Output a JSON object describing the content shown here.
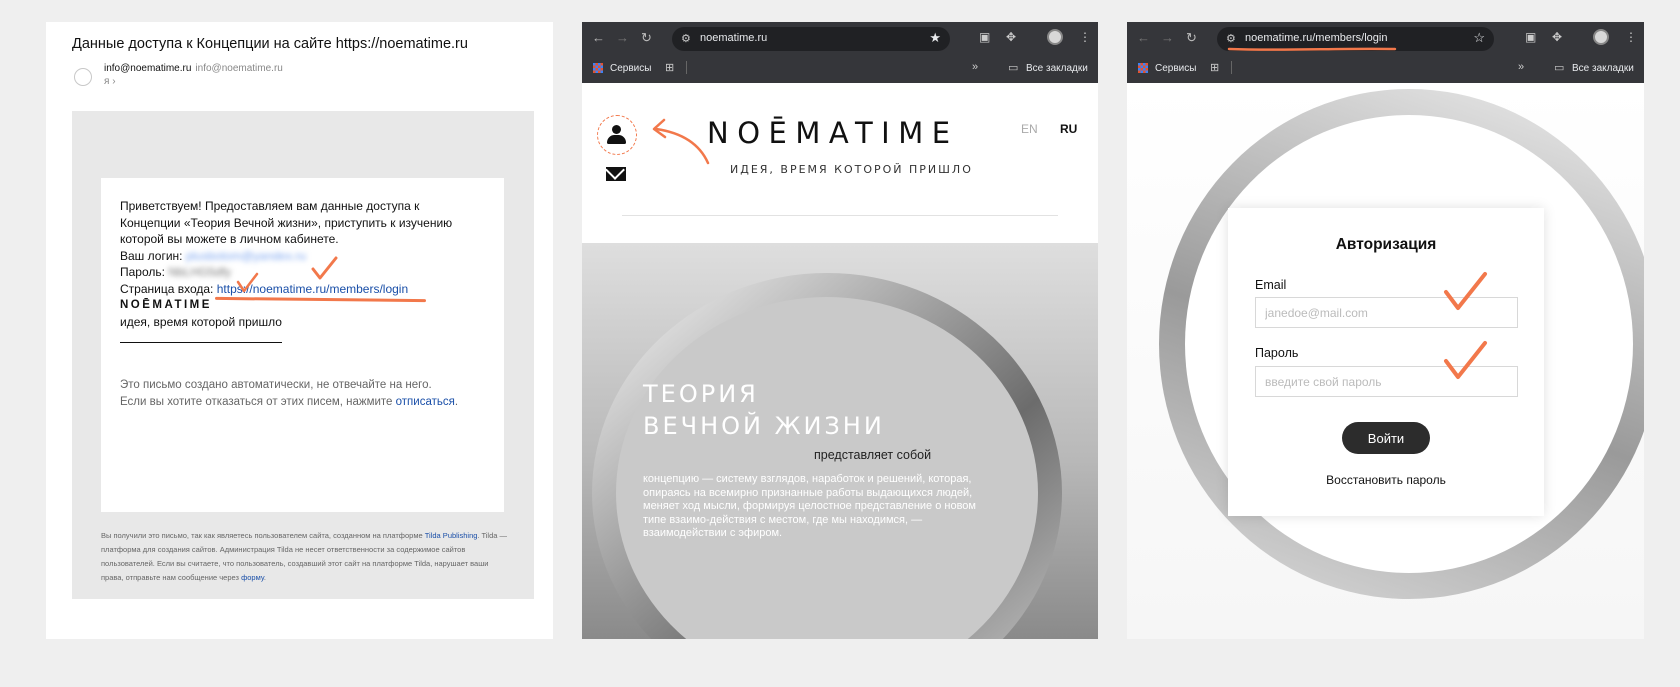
{
  "email": {
    "subject": "Данные доступа к Концепции на сайте https://noematime.ru",
    "from_name": "info@noematime.ru",
    "from_email": "info@noematime.ru",
    "to": "я ›",
    "greeting": "Приветствуем! Предоставляем вам данные доступа к Концепции «Теория Вечной жизни», приступить к изучению которой вы можете в личном кабинете.",
    "login_label": "Ваш логин:",
    "login_value": "plusbotom@yandex.ru",
    "password_label": "Пароль:",
    "password_value": "NbLHG5dfy",
    "login_page_label": "Страница входа:",
    "login_page_url": "https://noematime.ru/members/login",
    "brand": "NOĒMATIME",
    "tagline": "идея, время которой пришло",
    "notice_line1": "Это письмо создано автоматически, не отвечайте на него.",
    "notice_line2_prefix": "Если вы хотите отказаться от этих писем, нажмите",
    "unsubscribe": "отписаться",
    "notice_line2_suffix": ".",
    "footer_prefix": "Вы получили это письмо, так как являетесь пользователем сайта, созданном на платформе",
    "footer_link1": "Tilda Publishing",
    "footer_middle": ". Tilda — платформа для создания сайтов. Администрация Tilda не несет ответственности за содержимое сайтов пользователей. Если вы считаете, что пользователь, создавший этот сайт на платформе Tilda, нарушает ваши права, отправьте нам сообщение через",
    "footer_link2": "форму",
    "footer_suffix": "."
  },
  "browser_site": {
    "url": "noematime.ru",
    "bookmark_services": "Сервисы",
    "all_bookmarks": "Все закладки",
    "logo": "NOĒMATIME",
    "slogan": "ИДЕЯ, ВРЕМЯ КОТОРОЙ ПРИШЛО",
    "lang_en": "EN",
    "lang_ru": "RU",
    "hero_title_line1": "ТЕОРИЯ",
    "hero_title_line2": "ВЕЧНОЙ ЖИЗНИ",
    "hero_sub": "представляет собой",
    "hero_body": "концепцию — систему взглядов, наработок и решений, которая, опираясь на всемирно признанные работы выдающихся людей, меняет ход мысли, формируя целостное представление о новом типе взаимо-действия с местом, где мы находимся, — взаимодействии с эфиром."
  },
  "browser_auth": {
    "url": "noematime.ru/members/login",
    "bookmark_services": "Сервисы",
    "all_bookmarks": "Все закладки",
    "title": "Авторизация",
    "email_label": "Email",
    "email_placeholder": "janedoe@mail.com",
    "password_label": "Пароль",
    "password_placeholder": "введите свой пароль",
    "login_button": "Войти",
    "restore_link": "Восстановить пароль"
  },
  "colors": {
    "annotation": "#f2784b",
    "link": "#1a4fa8",
    "chrome": "#35363a",
    "button": "#2c2c2c"
  },
  "icons": [
    "back-arrow-icon",
    "forward-arrow-icon",
    "reload-icon",
    "site-settings-icon",
    "star-icon",
    "extension-icon",
    "profile-icon",
    "menu-dots-icon",
    "apps-grid-icon",
    "folder-icon",
    "user-icon",
    "mail-icon",
    "checkmark-icon",
    "arrow-annotation-icon"
  ]
}
